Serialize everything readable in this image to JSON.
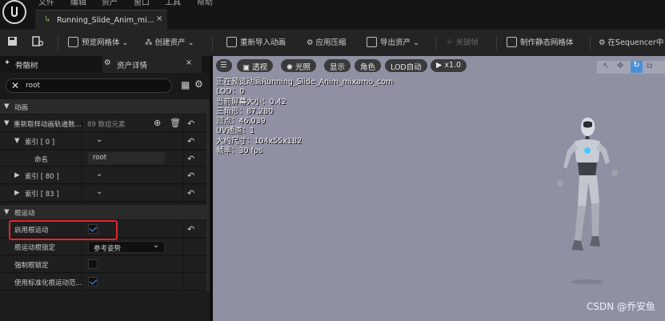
{
  "menu": [
    "文件",
    "编辑",
    "资产",
    "窗口",
    "工具",
    "帮助"
  ],
  "document_tab": {
    "label": "Running_Slide_Anim_mi...",
    "close": "×"
  },
  "toolbar": {
    "preview_mesh": "预览网格体",
    "create_asset": "创建资产",
    "reimport": "重新导入动画",
    "apply_compression": "应用压缩",
    "export_asset": "导出资产",
    "keyframe": "关键帧",
    "make_static_mesh": "制作静态网格体",
    "open_sequencer": "在Sequencer中"
  },
  "panel_tabs": {
    "skeleton_tree": "骨骼树",
    "asset_details": "资产详情",
    "close": "×"
  },
  "search": {
    "value": "root"
  },
  "details": {
    "section_animation": "动画",
    "track_names_label": "重新取样动画轨道数...",
    "track_names_value": "89 数组元素",
    "index0": "索引 [ 0 ]",
    "name_label": "命名",
    "name_value": "root",
    "index80": "索引 [ 80 ]",
    "index83": "索引 [ 83 ]",
    "section_root_motion": "根运动",
    "enable_root_motion": "启用根运动",
    "enable_root_motion_checked": true,
    "root_motion_lock": "根运动根锁定",
    "root_motion_lock_value": "参考姿势",
    "force_root_lock": "强制根锁定",
    "force_root_lock_checked": false,
    "normalized_root_motion": "使用标准化根运动范...",
    "normalized_root_motion_checked": true
  },
  "viewport": {
    "perspective": "透视",
    "lit": "光照",
    "show": "显示",
    "character": "角色",
    "lod": "LOD自动",
    "speed": "x1.0",
    "stats": [
      "正在预览动画Running_Slide_Anim_mixamo_com",
      "LOD：0",
      "当前屏幕大小：0.42",
      "三角形：87,280",
      "顶点：46,039",
      "UV通道：1",
      "大约尺寸：104x55x182",
      "帧率：30 fps"
    ]
  },
  "watermark": "CSDN @乔安鱼",
  "colors": {
    "highlight_box": "#e3262b",
    "check_color": "#3ea0ff",
    "viewport_bg": "#8f91a3"
  }
}
